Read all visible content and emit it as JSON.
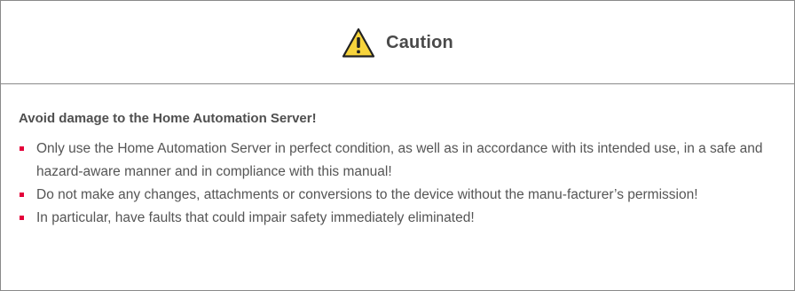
{
  "caution": {
    "title": "Caution",
    "icon": "warning-triangle-icon",
    "accent_color": "#f7d43c",
    "bullet_color": "#e4003a",
    "subtitle": "Avoid damage to the Home Automation Server!",
    "items": [
      "Only use the Home Automation Server in perfect condition, as well as in accordance with its intended use, in a safe and hazard-aware manner and in compliance with this manual!",
      "Do not make any changes, attachments or conversions to the device without the manu-facturer’s permission!",
      "In particular, have faults that could impair safety immediately eliminated!"
    ]
  }
}
